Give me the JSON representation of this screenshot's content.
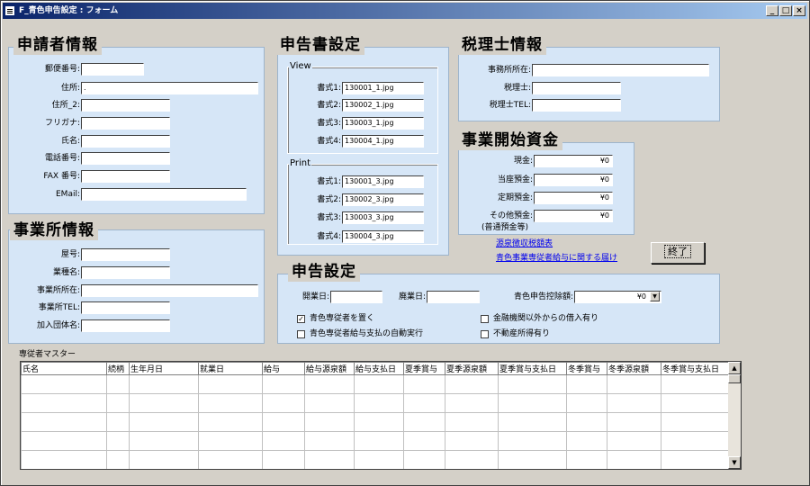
{
  "window": {
    "title": "F_青色申告設定 : フォーム",
    "min": "_",
    "max": "□",
    "close": "×"
  },
  "applicant": {
    "title": "申請者情報",
    "postal_label": "郵便番号:",
    "address_label": "住所:",
    "address2_label": "住所_2:",
    "furigana_label": "フリガナ:",
    "name_label": "氏名:",
    "phone_label": "電話番号:",
    "fax_label": "FAX 番号:",
    "email_label": "EMail:",
    "address_value": "."
  },
  "office": {
    "title": "事業所情報",
    "shop_label": "屋号:",
    "industry_label": "業種名:",
    "location_label": "事業所所在:",
    "tel_label": "事業所TEL:",
    "group_label": "加入団体名:"
  },
  "declaration": {
    "title": "申告書設定",
    "view_label": "View",
    "print_label": "Print",
    "view_items": [
      {
        "label": "書式1:",
        "value": "130001_1.jpg"
      },
      {
        "label": "書式2:",
        "value": "130002_1.jpg"
      },
      {
        "label": "書式3:",
        "value": "130003_1.jpg"
      },
      {
        "label": "書式4:",
        "value": "130004_1.jpg"
      }
    ],
    "print_items": [
      {
        "label": "書式1:",
        "value": "130001_3.jpg"
      },
      {
        "label": "書式2:",
        "value": "130002_3.jpg"
      },
      {
        "label": "書式3:",
        "value": "130003_3.jpg"
      },
      {
        "label": "書式4:",
        "value": "130004_3.jpg"
      }
    ]
  },
  "tax_accountant": {
    "title": "税理士情報",
    "office_label": "事務所所在:",
    "name_label": "税理士:",
    "tel_label": "税理士TEL:"
  },
  "funds": {
    "title": "事業開始資金",
    "cash_label": "現金:",
    "current_label": "当座預金:",
    "fixed_label": "定期預金:",
    "other_label": "その他預金:",
    "other_note": "(普通預金等)",
    "cash_value": "¥0",
    "current_value": "¥0",
    "fixed_value": "¥0",
    "other_value": "¥0"
  },
  "links": {
    "withholding": "源泉徴収税額表",
    "employee_salary": "青色事業専従者給与に関する届け"
  },
  "exit_button": "終了",
  "filing": {
    "title": "申告設定",
    "start_label": "開業日:",
    "close_label": "廃業日:",
    "deduction_label": "青色申告控除額:",
    "deduction_value": "¥0",
    "check1": "青色専従者を置く",
    "check2": "青色専従者給与支払の自動実行",
    "check3": "金融機関以外からの借入有り",
    "check4": "不動産所得有り",
    "check1_state": "✓",
    "check2_state": "",
    "check3_state": "",
    "check4_state": ""
  },
  "employee_master": {
    "label": "専従者マスター",
    "columns": [
      "氏名",
      "続柄",
      "生年月日",
      "就業日",
      "給与",
      "給与源泉額",
      "給与支払日",
      "夏季賞与",
      "夏季源泉額",
      "夏季賞与支払日",
      "冬季賞与",
      "冬季源泉額",
      "冬季賞与支払日"
    ]
  }
}
